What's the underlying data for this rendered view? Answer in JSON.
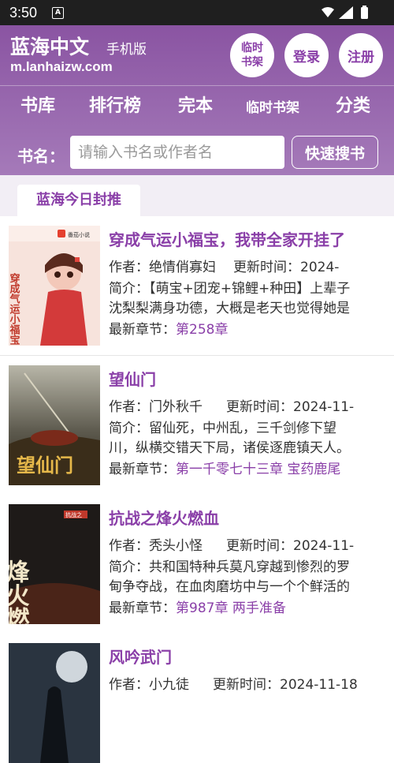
{
  "status_bar": {
    "time": "3:50",
    "app_icon": "A"
  },
  "header": {
    "title": "蓝海中文",
    "subtitle": "手机版",
    "domain": "m.lanhaizw.com",
    "buttons": {
      "shelf_line1": "临时",
      "shelf_line2": "书架",
      "login": "登录",
      "register": "注册"
    },
    "nav": [
      "书库",
      "排行榜",
      "完本",
      "临时书架",
      "分类"
    ],
    "search": {
      "label": "书名：",
      "placeholder": "请输入书名或作者名",
      "button": "快速搜书"
    }
  },
  "section": {
    "tab": "蓝海今日封推"
  },
  "labels": {
    "author": "作者：",
    "updated": "更新时间：",
    "intro": "简介：",
    "latest": "最新章节："
  },
  "books": [
    {
      "title": "穿成气运小福宝，我带全家开挂了",
      "author": "绝情俏寡妇",
      "updated": "2024-",
      "intro1": "【萌宝+团宠+锦鲤+种田】上辈子",
      "intro2": "沈梨梨满身功德，大概是老天也觉得她是",
      "latest": "第258章",
      "cover_text": "穿成气运小福宝 我带全家开挂了",
      "cover_brand": "番茄小说"
    },
    {
      "title": "望仙门",
      "author": "门外秋千",
      "updated": "2024-11-",
      "intro1": "留仙死，中州乱，三千剑修下望",
      "intro2": "川，纵横交错天下局，诸侯逐鹿镇天人。",
      "latest": "第一千零七十三章 宝药鹿尾",
      "cover_text": "望仙门"
    },
    {
      "title": "抗战之烽火燃血",
      "author": "秃头小怪",
      "updated": "2024-11-",
      "intro1": "共和国特种兵莫凡穿越到惨烈的罗",
      "intro2": "甸争夺战，在血肉磨坊中与一个个鲜活的",
      "latest": "第987章 两手准备",
      "cover_text": "烽火燃血",
      "cover_small": "抗战之"
    },
    {
      "title": "风吟武门",
      "author": "小九徒",
      "updated": "2024-11-18"
    }
  ],
  "colors": {
    "brand": "#8a54a2",
    "accent": "#8a3fa8",
    "section_bg": "#f2eef5"
  }
}
